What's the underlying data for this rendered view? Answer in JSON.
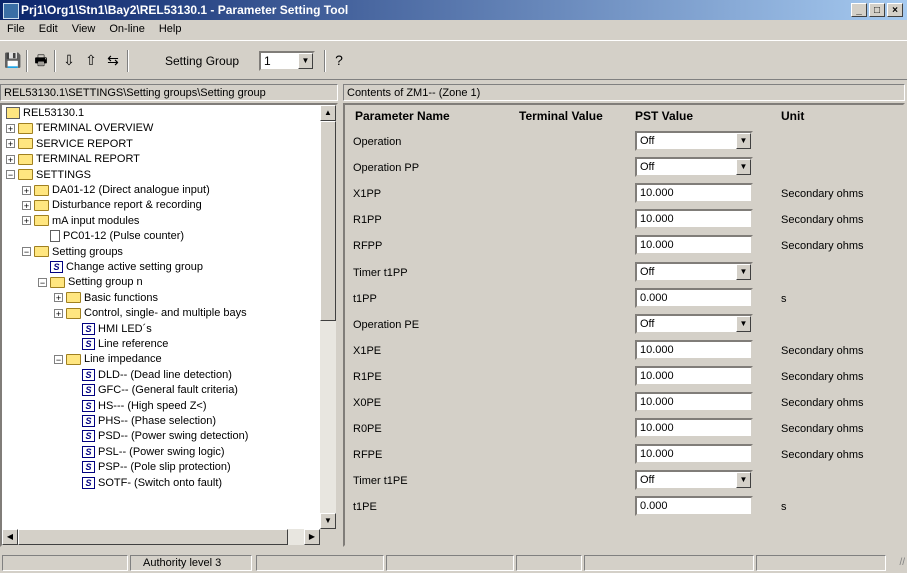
{
  "window": {
    "title": "Prj1\\Org1\\Stn1\\Bay2\\REL53130.1 - Parameter Setting Tool"
  },
  "menu": [
    "File",
    "Edit",
    "View",
    "On-line",
    "Help"
  ],
  "toolbar": {
    "setting_group_label": "Setting Group",
    "setting_group_value": "1"
  },
  "path": "REL53130.1\\SETTINGS\\Setting groups\\Setting group",
  "contents_title": "Contents of ZM1-- (Zone 1)",
  "tree": [
    {
      "label": "REL53130.1",
      "icon": "root"
    },
    {
      "label": "TERMINAL OVERVIEW",
      "icon": "folder",
      "exp": "+"
    },
    {
      "label": "SERVICE REPORT",
      "icon": "folder",
      "exp": "+"
    },
    {
      "label": "TERMINAL REPORT",
      "icon": "folder",
      "exp": "+"
    },
    {
      "label": "SETTINGS",
      "icon": "folder",
      "exp": "-"
    },
    {
      "label": "DA01-12 (Direct analogue input)",
      "icon": "folder",
      "exp": "+"
    },
    {
      "label": "Disturbance report & recording",
      "icon": "folder",
      "exp": "+"
    },
    {
      "label": "mA input modules",
      "icon": "folder",
      "exp": "+"
    },
    {
      "label": "PC01-12 (Pulse counter)",
      "icon": "doc"
    },
    {
      "label": "Setting groups",
      "icon": "folder",
      "exp": "-"
    },
    {
      "label": "Change active setting group",
      "icon": "s"
    },
    {
      "label": "Setting group n",
      "icon": "folder",
      "exp": "-"
    },
    {
      "label": "Basic functions",
      "icon": "folder",
      "exp": "+"
    },
    {
      "label": "Control, single- and multiple bays",
      "icon": "folder",
      "exp": "+"
    },
    {
      "label": "HMI LED´s",
      "icon": "s"
    },
    {
      "label": "Line reference",
      "icon": "s"
    },
    {
      "label": "Line impedance",
      "icon": "folder",
      "exp": "-"
    },
    {
      "label": "DLD-- (Dead line detection)",
      "icon": "s"
    },
    {
      "label": "GFC-- (General fault criteria)",
      "icon": "s"
    },
    {
      "label": "HS--- (High speed Z<)",
      "icon": "s"
    },
    {
      "label": "PHS-- (Phase selection)",
      "icon": "s"
    },
    {
      "label": "PSD-- (Power swing detection)",
      "icon": "s"
    },
    {
      "label": "PSL-- (Power swing logic)",
      "icon": "s"
    },
    {
      "label": "PSP-- (Pole slip protection)",
      "icon": "s"
    },
    {
      "label": "SOTF- (Switch onto fault)",
      "icon": "s"
    }
  ],
  "param_headers": {
    "name": "Parameter Name",
    "terminal": "Terminal Value",
    "pst": "PST Value",
    "unit": "Unit"
  },
  "params": [
    {
      "name": "Operation",
      "value": "Off",
      "type": "dropdown",
      "unit": ""
    },
    {
      "name": "Operation PP",
      "value": "Off",
      "type": "dropdown",
      "unit": ""
    },
    {
      "name": "X1PP",
      "value": "10.000",
      "type": "text",
      "unit": "Secondary ohms"
    },
    {
      "name": "R1PP",
      "value": "10.000",
      "type": "text",
      "unit": "Secondary ohms"
    },
    {
      "name": "RFPP",
      "value": "10.000",
      "type": "text",
      "unit": "Secondary ohms"
    },
    {
      "name": "Timer t1PP",
      "value": "Off",
      "type": "dropdown",
      "unit": ""
    },
    {
      "name": "t1PP",
      "value": "0.000",
      "type": "text",
      "unit": "s"
    },
    {
      "name": "Operation PE",
      "value": "Off",
      "type": "dropdown",
      "unit": ""
    },
    {
      "name": "X1PE",
      "value": "10.000",
      "type": "text",
      "unit": "Secondary ohms"
    },
    {
      "name": "R1PE",
      "value": "10.000",
      "type": "text",
      "unit": "Secondary ohms"
    },
    {
      "name": "X0PE",
      "value": "10.000",
      "type": "text",
      "unit": "Secondary ohms"
    },
    {
      "name": "R0PE",
      "value": "10.000",
      "type": "text",
      "unit": "Secondary ohms"
    },
    {
      "name": "RFPE",
      "value": "10.000",
      "type": "text",
      "unit": "Secondary ohms"
    },
    {
      "name": "Timer t1PE",
      "value": "Off",
      "type": "dropdown",
      "unit": ""
    },
    {
      "name": "t1PE",
      "value": "0.000",
      "type": "text",
      "unit": "s"
    }
  ],
  "status": {
    "authority": "Authority level  3"
  }
}
